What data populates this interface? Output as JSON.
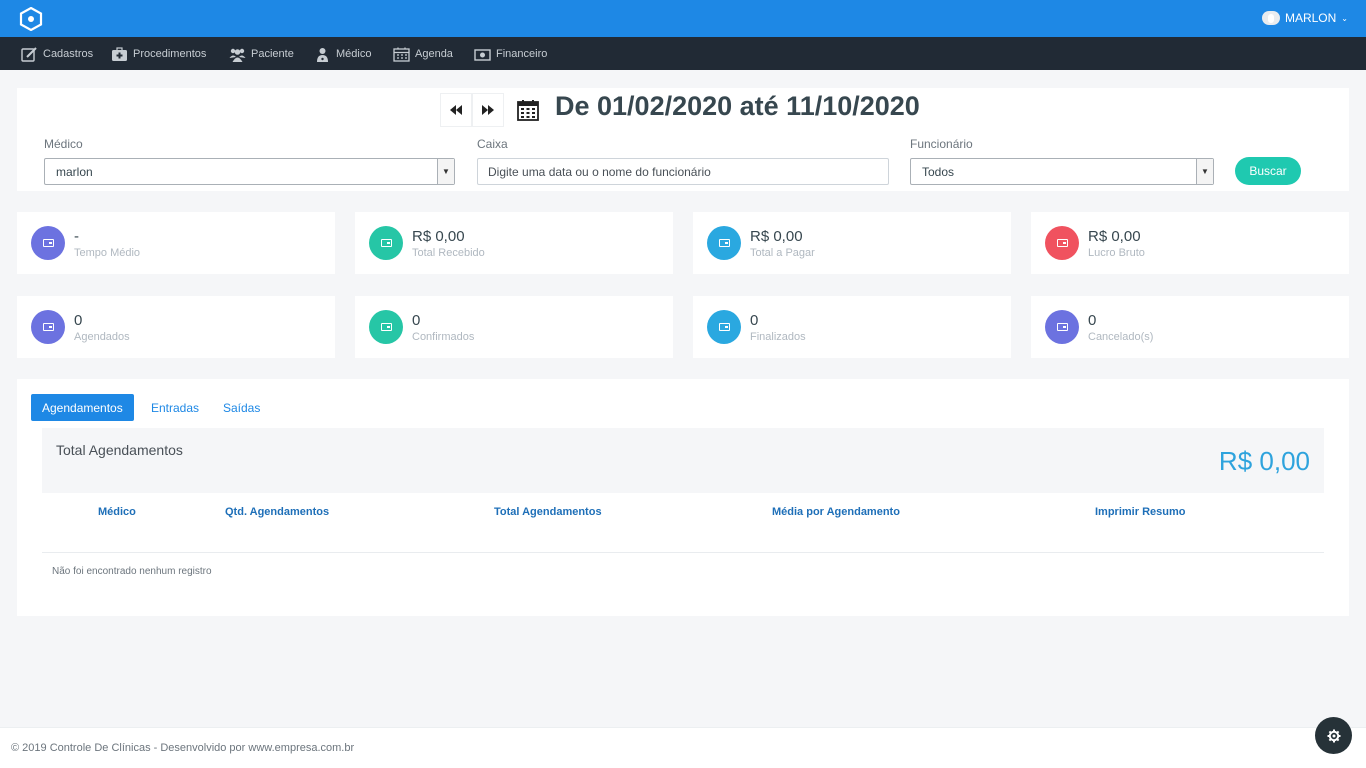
{
  "topbar": {
    "user_name": "MARLON",
    "chevron": "⌄"
  },
  "nav": [
    {
      "label": "Cadastros",
      "icon": "edit-icon"
    },
    {
      "label": "Procedimentos",
      "icon": "medical-kit-icon"
    },
    {
      "label": "Paciente",
      "icon": "users-icon"
    },
    {
      "label": "Médico",
      "icon": "doctor-icon"
    },
    {
      "label": "Agenda",
      "icon": "calendar-icon"
    },
    {
      "label": "Financeiro",
      "icon": "money-icon"
    }
  ],
  "filter": {
    "prev_label": "◀◀",
    "next_label": "▶▶",
    "date_range": "De 01/02/2020 até 11/10/2020",
    "medico_label": "Médico",
    "medico_value": "marlon",
    "caixa_label": "Caixa",
    "caixa_placeholder": "Digite uma data ou o nome do funcionário",
    "funcionario_label": "Funcionário",
    "funcionario_value": "Todos",
    "buscar_label": "Buscar"
  },
  "stats": [
    {
      "value": "-",
      "label": "Tempo Médio",
      "color": "#6c72e0"
    },
    {
      "value": "R$ 0,00",
      "label": "Total Recebido",
      "color": "#26c6a6"
    },
    {
      "value": "R$ 0,00",
      "label": "Total a Pagar",
      "color": "#2aa8e0"
    },
    {
      "value": "R$ 0,00",
      "label": "Lucro Bruto",
      "color": "#f0525f"
    },
    {
      "value": "0",
      "label": "Agendados",
      "color": "#6c72e0"
    },
    {
      "value": "0",
      "label": "Confirmados",
      "color": "#26c6a6"
    },
    {
      "value": "0",
      "label": "Finalizados",
      "color": "#2aa8e0"
    },
    {
      "value": "0",
      "label": "Cancelado(s)",
      "color": "#6c72e0"
    }
  ],
  "tabs": [
    {
      "label": "Agendamentos",
      "active": true
    },
    {
      "label": "Entradas",
      "active": false
    },
    {
      "label": "Saídas",
      "active": false
    }
  ],
  "summary": {
    "title": "Total Agendamentos",
    "value": "R$ 0,00"
  },
  "table": {
    "headers": [
      "Médico",
      "Qtd. Agendamentos",
      "Total Agendamentos",
      "Média por Agendamento",
      "Imprimir Resumo"
    ],
    "empty_text": "Não foi encontrado nenhum registro"
  },
  "footer": {
    "text": "© 2019 Controle De Clínicas - Desenvolvido por www.empresa.com.br"
  },
  "colors": {
    "topbar": "#1e88e5",
    "navbar": "#212a35",
    "accent": "#1e88e5",
    "buscar": "#1fc9b0"
  }
}
